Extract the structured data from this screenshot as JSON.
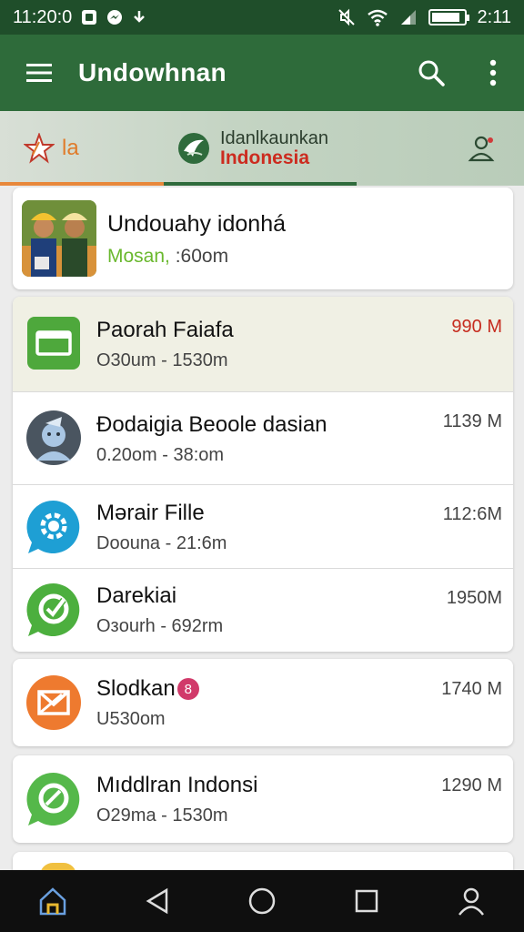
{
  "status_bar": {
    "time": "11:20:0",
    "battery_time": "2:11",
    "battery_level": 0.9
  },
  "app_bar": {
    "title": "Undowhnan"
  },
  "tabs": [
    {
      "label": "la"
    },
    {
      "line1": "Idanlkaunkan",
      "line2": "Indonesia"
    },
    {
      "label": ""
    }
  ],
  "featured": {
    "title": "Undouahy idonhá",
    "sub_green": "Mosan,",
    "sub_rest": " :60om"
  },
  "items": [
    {
      "title": "Paorah Faiafa",
      "subtitle": "O30um - 1530m",
      "size": "990 M",
      "icon": "folder-icon",
      "color": "#4ea83c"
    },
    {
      "title": "Đodaigia Beoole dasian",
      "subtitle": "0.20om - 38:om",
      "size": "1139 M",
      "icon": "avatar-icon",
      "color": "#4a5560"
    },
    {
      "title": "Mərair Fille",
      "subtitle": "Doouna - 21:6m",
      "size": "112:6M",
      "icon": "gear-chat-icon",
      "color": "#1e9fd4"
    },
    {
      "title": "Darekiai",
      "subtitle": "Oзourh - 692rm",
      "size": "1950M",
      "icon": "check-chat-icon",
      "color": "#4caf3e"
    },
    {
      "title": "Slodkan",
      "badge": "8",
      "subtitle": "U530om",
      "size": "1740 M",
      "icon": "envelope-icon",
      "color": "#ee7a2f"
    },
    {
      "title": "Mıddlran Indonsi",
      "subtitle": "O29ma - 1530m",
      "size": "1290 M",
      "icon": "chat-icon",
      "color": "#55b84a"
    }
  ]
}
